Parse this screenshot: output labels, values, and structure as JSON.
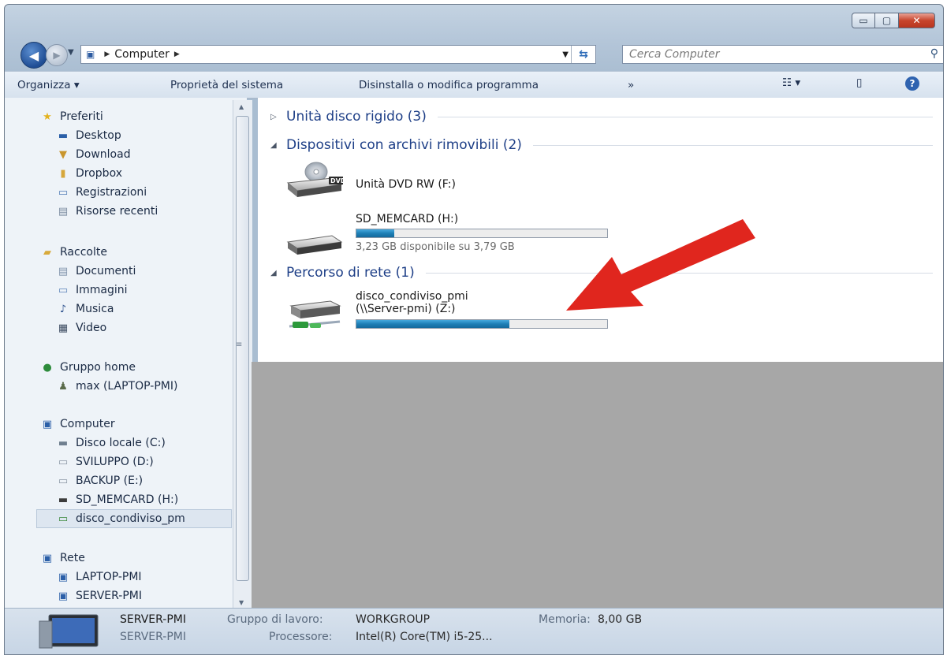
{
  "window": {
    "controls": {
      "minimize": "▭",
      "maximize": "▢",
      "close": "✕"
    }
  },
  "address_bar": {
    "crumbs": [
      "Computer"
    ],
    "search_placeholder": "Cerca Computer"
  },
  "command_bar": {
    "organize": "Organizza ▾",
    "system_properties": "Proprietà del sistema",
    "uninstall": "Disinstalla o modifica programma",
    "more": "»",
    "view": "☷ ▾",
    "preview": "▯",
    "help": "?"
  },
  "navigation": {
    "favorites": {
      "label": "Preferiti",
      "items": [
        "Desktop",
        "Download",
        "Dropbox",
        "Registrazioni",
        "Risorse recenti"
      ]
    },
    "libraries": {
      "label": "Raccolte",
      "items": [
        "Documenti",
        "Immagini",
        "Musica",
        "Video"
      ]
    },
    "homegroup": {
      "label": "Gruppo home",
      "items": [
        "max (LAPTOP-PMI)"
      ]
    },
    "computer": {
      "label": "Computer",
      "items": [
        "Disco locale (C:)",
        "SVILUPPO (D:)",
        "BACKUP (E:)",
        "SD_MEMCARD (H:)",
        "disco_condiviso_pm"
      ]
    },
    "network": {
      "label": "Rete",
      "items": [
        "LAPTOP-PMI",
        "SERVER-PMI"
      ]
    }
  },
  "content": {
    "groups": {
      "hard_disks": "Unità disco rigido (3)",
      "removable": "Dispositivi con archivi rimovibili (2)",
      "network": "Percorso di rete (1)"
    },
    "dvd": {
      "name": "Unità DVD RW (F:)",
      "icon_label": "DVD"
    },
    "sd": {
      "name": "SD_MEMCARD (H:)",
      "free": "3,23 GB disponibile su 3,79 GB",
      "used_fraction": 0.15
    },
    "share": {
      "name_line1": "disco_condiviso_pmi",
      "name_line2": "(\\\\Server-pmi) (Z:)",
      "used_fraction": 0.61
    }
  },
  "details": {
    "computer_name": "SERVER-PMI",
    "computer_name_2": "SERVER-PMI",
    "workgroup_label": "Gruppo di lavoro:",
    "workgroup_value": "WORKGROUP",
    "memory_label": "Memoria:",
    "memory_value": "8,00 GB",
    "processor_label": "Processore:",
    "processor_value": "Intel(R) Core(TM) i5-25..."
  },
  "colors": {
    "accent_blue": "#1e3f87",
    "progress": "#1e7fb6",
    "arrow": "#e0261e"
  }
}
